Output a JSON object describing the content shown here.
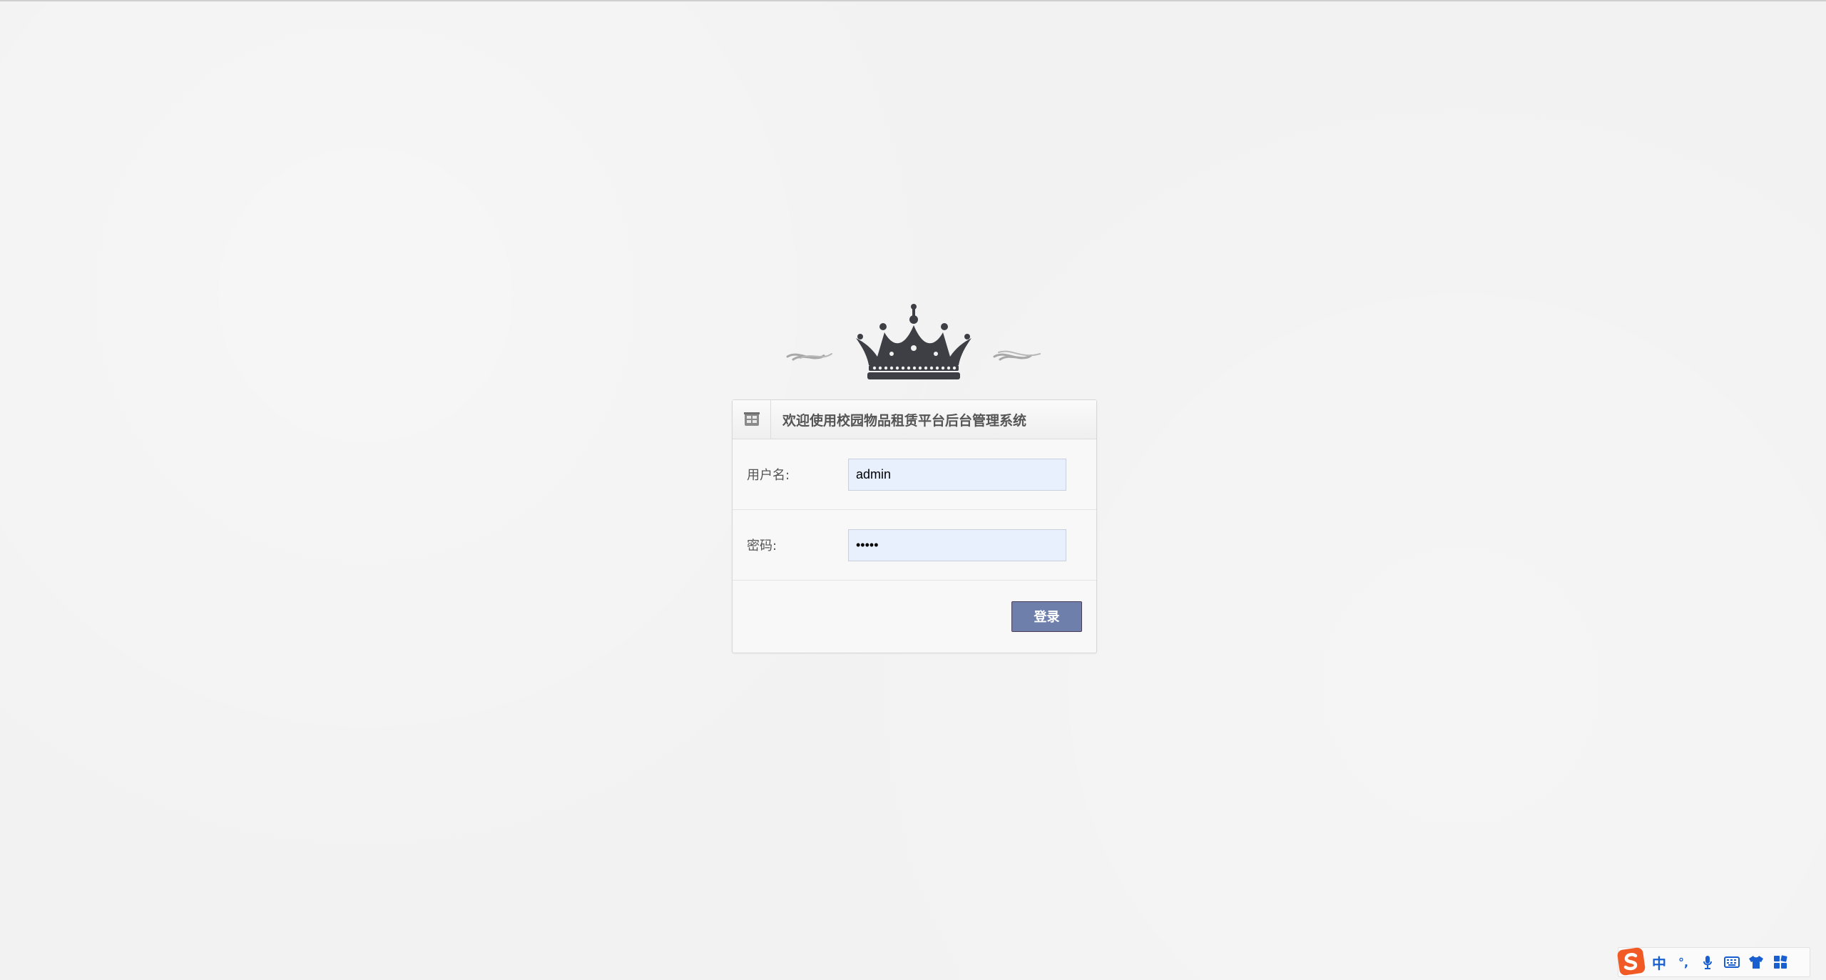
{
  "login": {
    "title": "欢迎使用校园物品租赁平台后台管理系统",
    "username_label": "用户名:",
    "username_value": "admin",
    "password_label": "密码:",
    "password_value": "•••••",
    "submit_label": "登录"
  },
  "ime": {
    "lang_label": "中",
    "punct_label": "°,",
    "icons": [
      "sogou-logo-icon",
      "microphone-icon",
      "keyboard-icon",
      "skin-shirt-icon",
      "toolbox-grid-icon"
    ]
  },
  "colors": {
    "button_bg": "#6f7fab",
    "input_bg": "#e8f0fe",
    "ime_accent": "#1a5fd0",
    "ime_logo": "#f15a24"
  }
}
